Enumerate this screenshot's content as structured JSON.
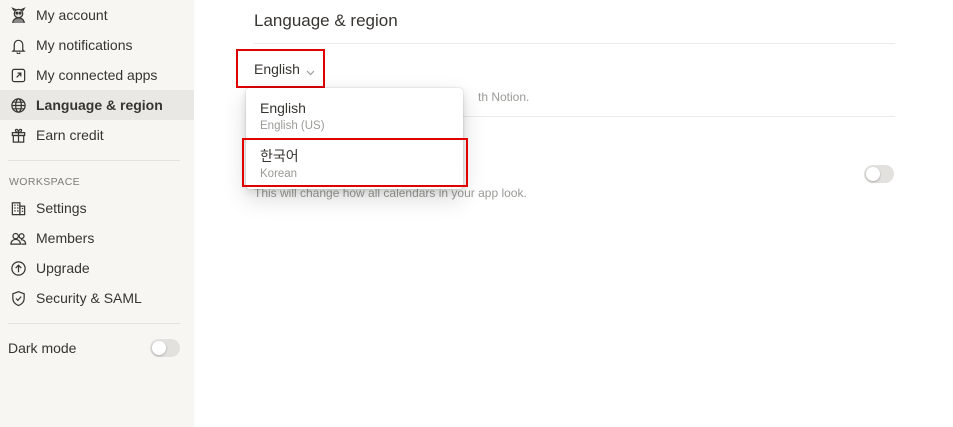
{
  "sidebar": {
    "items": [
      {
        "label": "My account",
        "icon": "avatar-icon",
        "active": false
      },
      {
        "label": "My notifications",
        "icon": "bell-icon",
        "active": false
      },
      {
        "label": "My connected apps",
        "icon": "external-link-icon",
        "active": false
      },
      {
        "label": "Language & region",
        "icon": "globe-icon",
        "active": true
      },
      {
        "label": "Earn credit",
        "icon": "gift-icon",
        "active": false
      }
    ],
    "workspace_label": "WORKSPACE",
    "workspace_items": [
      {
        "label": "Settings",
        "icon": "building-icon"
      },
      {
        "label": "Members",
        "icon": "people-icon"
      },
      {
        "label": "Upgrade",
        "icon": "arrow-up-circle-icon"
      },
      {
        "label": "Security & SAML",
        "icon": "shield-icon"
      }
    ],
    "dark_mode_label": "Dark mode",
    "dark_mode_on": false
  },
  "main": {
    "title": "Language & region",
    "language_select": {
      "value": "English"
    },
    "language_desc_visible": "th Notion.",
    "calendar_desc": "This will change how all calendars in your app look.",
    "calendar_toggle_on": false
  },
  "dropdown": {
    "options": [
      {
        "title": "English",
        "subtitle": "English (US)"
      },
      {
        "title": "한국어",
        "subtitle": "Korean"
      }
    ]
  },
  "colors": {
    "sidebar_bg": "#f7f6f3",
    "active_bg": "#e9e8e4",
    "highlight": "#e00000",
    "text": "#37352f",
    "muted": "#9b9a97"
  }
}
